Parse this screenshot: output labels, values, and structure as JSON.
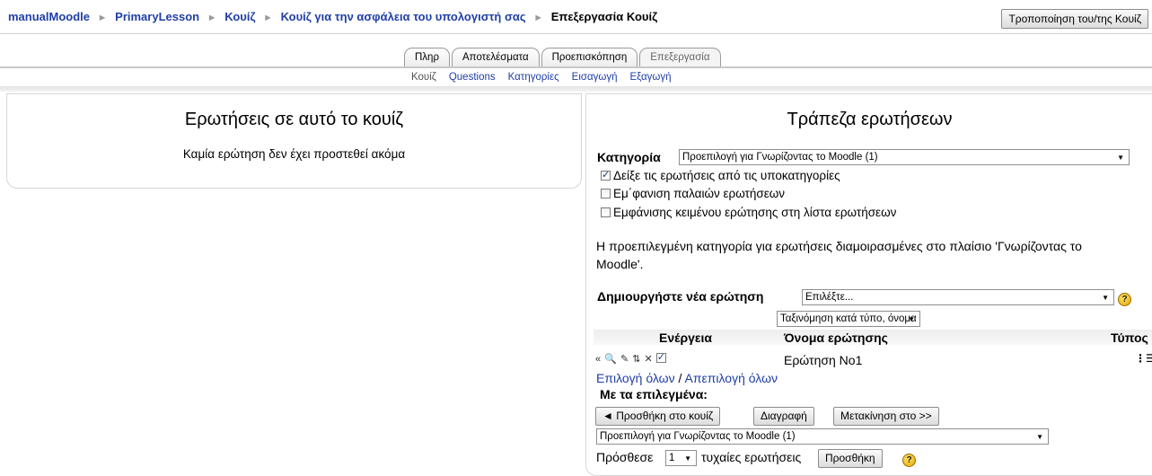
{
  "breadcrumb": {
    "items": [
      "manualMoodle",
      "PrimaryLesson",
      "Κουίζ",
      "Κουίζ για την ασφάλεια του υπολογιστή σας"
    ],
    "current": "Επεξεργασία Κουίζ"
  },
  "header": {
    "update_button": "Τροποποίηση του/της Κουίζ"
  },
  "tabs": [
    {
      "label": "Πληρ"
    },
    {
      "label": "Αποτελέσματα"
    },
    {
      "label": "Προεπισκόπηση"
    },
    {
      "label": "Επεξεργασία"
    }
  ],
  "subtabs": [
    {
      "label": "Κουίζ"
    },
    {
      "label": "Questions"
    },
    {
      "label": "Κατηγορίες"
    },
    {
      "label": "Εισαγωγή"
    },
    {
      "label": "Εξαγωγή"
    }
  ],
  "left": {
    "title": "Ερωτήσεις σε αυτό το κουίζ",
    "empty_text": "Καμία ερώτηση δεν έχει προστεθεί ακόμα"
  },
  "right": {
    "title": "Τράπεζα ερωτήσεων",
    "category_label": "Κατηγορία",
    "category_value": "Προεπιλογή για Γνωρίζοντας το Moodle (1)",
    "options": [
      {
        "label": "Δείξε τις ερωτήσεις από τις υποκατηγορίες",
        "checked": true
      },
      {
        "label": "Εμ΄φανιση παλαιών ερωτήσεων",
        "checked": false
      },
      {
        "label": "Εμφάνισης κειμένου ερώτησης στη λίστα ερωτήσεων",
        "checked": false
      }
    ],
    "description_line1": "Η προεπιλεγμένη κατηγορία για ερωτήσεις διαμοιρασμένες στο πλαίσιο 'Γνωρίζοντας το",
    "description_line2": "Moodle'.",
    "create_label": "Δημιουργήστε νέα ερώτηση",
    "create_select": "Επιλέξτε...",
    "sort_select": "Ταξινόμηση κατά τύπο, όνομα",
    "columns": {
      "action": "Ενέργεια",
      "name": "Όνομα ερώτησης",
      "type": "Τύπος"
    },
    "rows": [
      {
        "name": "Ερώτηση Νο1",
        "checked": true
      }
    ],
    "select_all": "Επιλογή όλων",
    "slash": "/",
    "deselect_all": "Απεπιλογή όλων",
    "with_selected": "Με τα επιλεγμένα:",
    "btn_add": "◄ Προσθήκη στο κουίζ",
    "btn_delete": "Διαγραφή",
    "btn_move": "Μετακίνηση στο >>",
    "move_select": "Προεπιλογή για Γνωρίζοντας το Moodle (1)",
    "random_prefix": "Πρόσθεσε",
    "random_count": "1",
    "random_suffix": "τυχαίες ερωτήσεις",
    "btn_random_add": "Προσθήκη"
  },
  "colors": {
    "link": "#1f3fa6",
    "border": "#d6d6d6"
  }
}
